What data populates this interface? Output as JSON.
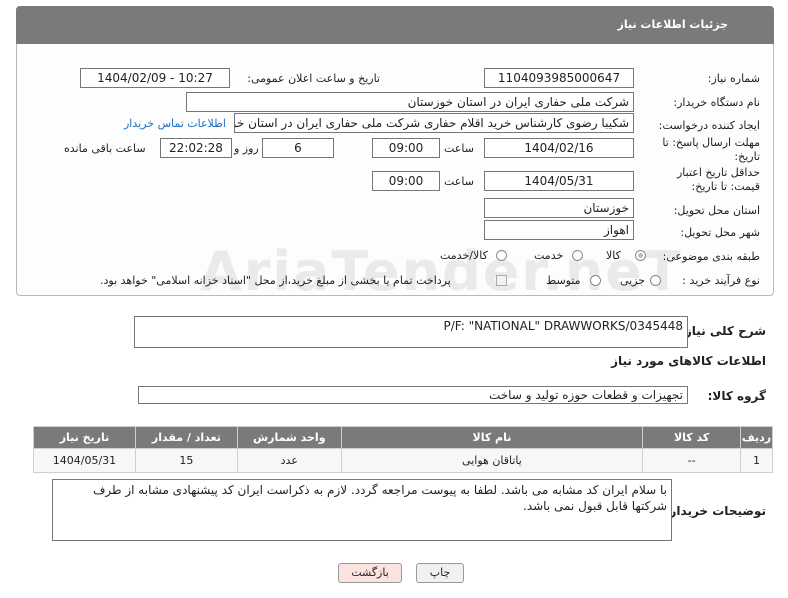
{
  "header": {
    "title": "جزئیات اطلاعات نیاز"
  },
  "need_number": {
    "label": "شماره نیاز:",
    "value": "1104093985000647"
  },
  "announce": {
    "label": "تاریخ و ساعت اعلان عمومی:",
    "value": "1404/02/09 - 10:27"
  },
  "buyer_org": {
    "label": "نام دستگاه خریدار:",
    "value": "شرکت ملی حفاری ایران در استان خوزستان"
  },
  "creator": {
    "label": "ایجاد کننده درخواست:",
    "value": "شکیبا رضوی کارشناس خرید اقلام حفاری شرکت ملی حفاری ایران در استان خوزستان",
    "contact_link": "اطلاعات تماس خریدار"
  },
  "deadline": {
    "label": "مهلت ارسال پاسخ: تا تاریخ:",
    "date": "1404/02/16",
    "time_label": "ساعت",
    "time": "09:00",
    "days": "6",
    "days_label": "روز و",
    "remaining": "22:02:28",
    "remaining_label": "ساعت باقی مانده"
  },
  "min_price": {
    "label": "حداقل تاریخ اعتبار قیمت: تا تاریخ:",
    "date": "1404/05/31",
    "time_label": "ساعت",
    "time": "09:00"
  },
  "province": {
    "label": "استان محل تحویل:",
    "value": "خوزستان"
  },
  "city": {
    "label": "شهر محل تحویل:",
    "value": "اهواز"
  },
  "category": {
    "label": "طبقه بندی موضوعی:",
    "options": [
      "کالا",
      "خدمت",
      "کالا/خدمت"
    ],
    "selected": "کالا"
  },
  "process": {
    "label": "نوع فرآیند خرید :",
    "options": [
      "جزیی",
      "متوسط"
    ],
    "note": "پرداخت تمام یا بخشی از مبلغ خرید،از محل \"اسناد خزانه اسلامی\" خواهد بود."
  },
  "watermark": "AriaTender.neT",
  "description": {
    "label": "شرح کلی نیاز:",
    "value": "P/F: \"NATIONAL\" DRAWWORKS/0345448"
  },
  "goods_info": {
    "title": "اطلاعات کالاهای مورد نیاز"
  },
  "goods_group": {
    "label": "گروه کالا:",
    "value": "تجهیزات و قطعات حوزه تولید و ساخت"
  },
  "table": {
    "headers": [
      "ردیف",
      "کد کالا",
      "نام کالا",
      "واحد شمارش",
      "تعداد / مقدار",
      "تاریخ نیاز"
    ],
    "rows": [
      [
        "1",
        "--",
        "یاتاقان هوایی",
        "عدد",
        "15",
        "1404/05/31"
      ]
    ]
  },
  "buyer_notes": {
    "label": "توضیحات خریدار:",
    "value": "با سلام ایران کد مشابه می باشد. لطفا به پیوست مراجعه گردد. لازم به ذکراست ایران کد پیشنهادی مشابه از طرف شرکتها قابل قبول نمی باشد."
  },
  "buttons": {
    "print": "چاپ",
    "back": "بازگشت"
  }
}
